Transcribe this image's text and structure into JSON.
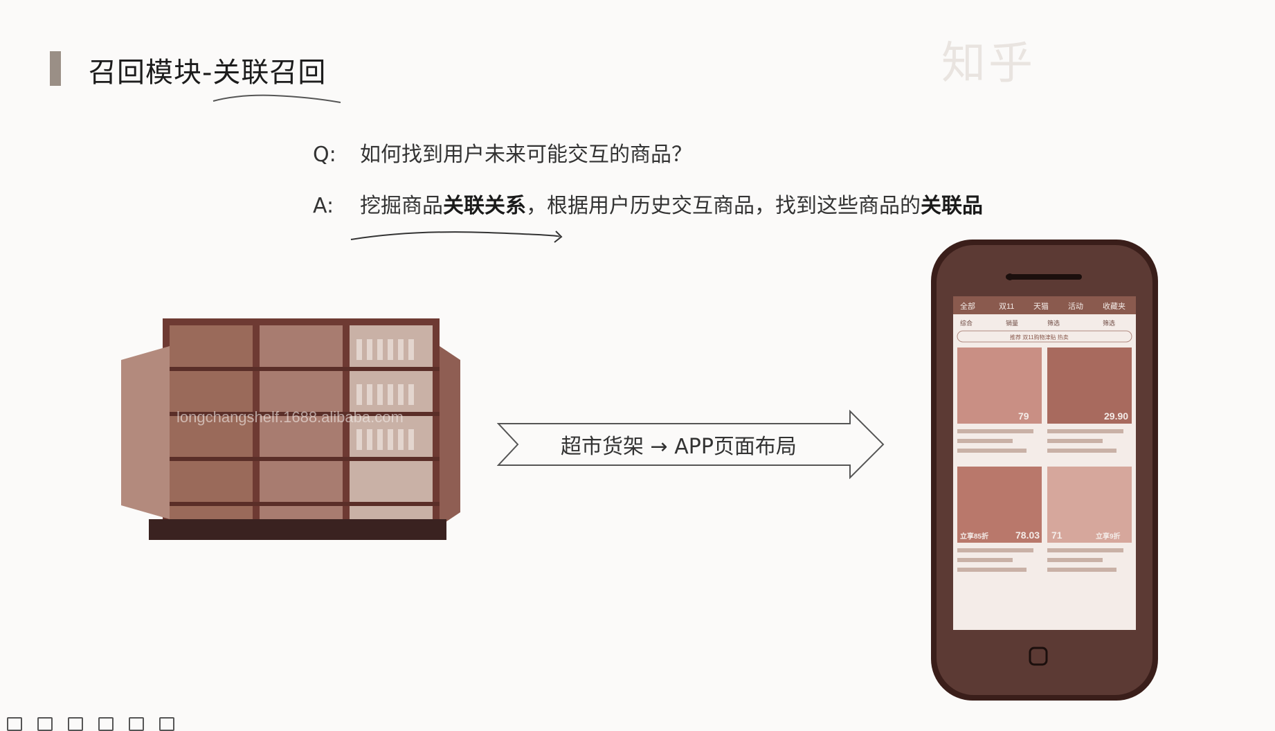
{
  "slide": {
    "title": "召回模块-关联召回",
    "question_label": "Q:",
    "question_text": "如何找到用户未来可能交互的商品？",
    "answer_label": "A:",
    "answer_part1": "挖掘商品",
    "answer_bold1": "关联关系",
    "answer_part2": "，根据用户历史交互商品，找到这些商品的",
    "answer_bold2": "关联品",
    "arrow_label": "超市货架 → APP页面布局",
    "shelf_watermark": "longchangshelf.1688.alibaba.com",
    "watermark": "知乎"
  },
  "phone": {
    "tabs": [
      "全部",
      "双11",
      "天猫",
      "活动",
      "收藏夹"
    ],
    "filters": [
      "综合",
      "销量",
      "筛选",
      "筛选"
    ],
    "search_hint": "推荐 双11购物津贴 热卖",
    "prices": [
      "79",
      "29.90",
      "78.03",
      "71"
    ],
    "badges": [
      "立享85折",
      "立享9折"
    ]
  },
  "colors": {
    "accent": "#9a8f86",
    "tone": "#8a5a4e"
  }
}
